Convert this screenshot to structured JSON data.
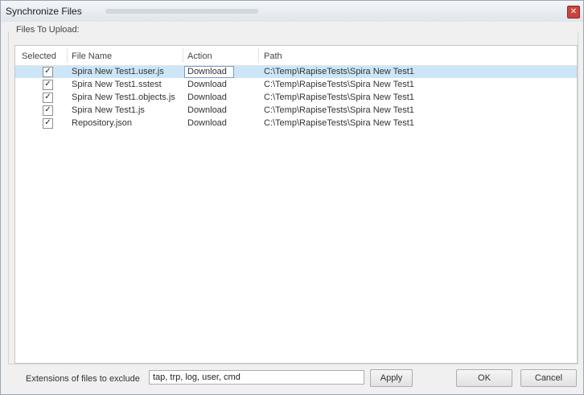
{
  "window": {
    "title": "Synchronize Files",
    "close_glyph": "✕"
  },
  "group": {
    "title": "Files To Upload:"
  },
  "grid": {
    "columns": [
      "Selected",
      "File Name",
      "Action",
      "Path"
    ],
    "rows": [
      {
        "checked": "✓",
        "file": "Spira New Test1.user.js",
        "action": "Download",
        "path": "C:\\Temp\\RapiseTests\\Spira New Test1"
      },
      {
        "checked": "✓",
        "file": "Spira New Test1.sstest",
        "action": "Download",
        "path": "C:\\Temp\\RapiseTests\\Spira New Test1"
      },
      {
        "checked": "✓",
        "file": "Spira New Test1.objects.js",
        "action": "Download",
        "path": "C:\\Temp\\RapiseTests\\Spira New Test1"
      },
      {
        "checked": "✓",
        "file": "Spira New Test1.js",
        "action": "Download",
        "path": "C:\\Temp\\RapiseTests\\Spira New Test1"
      },
      {
        "checked": "✓",
        "file": "Repository.json",
        "action": "Download",
        "path": "C:\\Temp\\RapiseTests\\Spira New Test1"
      }
    ]
  },
  "footer": {
    "exclude_label": "Extensions of files to exclude",
    "exclude_value": "tap, trp, log, user, cmd",
    "apply_label": "Apply",
    "ok_label": "OK",
    "cancel_label": "Cancel"
  },
  "colors": {
    "selected_row": "#cde6f7",
    "title_bar": "#dfe5ec",
    "close_button": "#c9463c"
  }
}
